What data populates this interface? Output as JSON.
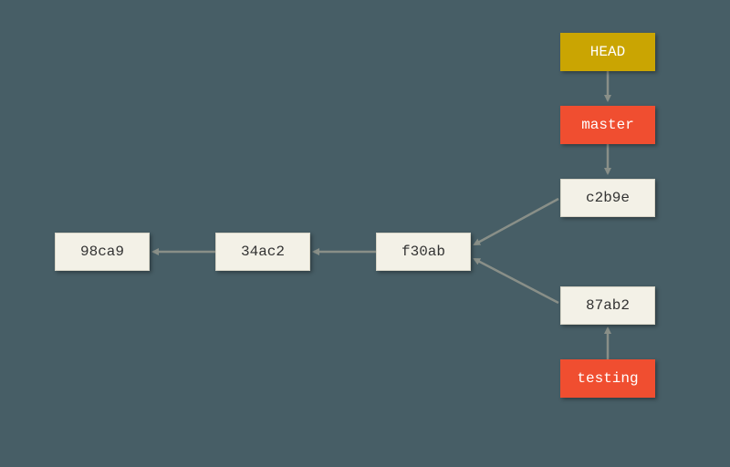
{
  "diagram": {
    "head": {
      "label": "HEAD"
    },
    "branches": {
      "master": {
        "label": "master"
      },
      "testing": {
        "label": "testing"
      }
    },
    "commits": {
      "c0": {
        "label": "98ca9"
      },
      "c1": {
        "label": "34ac2"
      },
      "c2": {
        "label": "f30ab"
      },
      "c3": {
        "label": "c2b9e"
      },
      "c4": {
        "label": "87ab2"
      }
    }
  },
  "colors": {
    "background": "#475e66",
    "commit_bg": "#f3f1e7",
    "branch_bg": "#f04e30",
    "head_bg": "#caa502",
    "arrow": "#898f88"
  }
}
